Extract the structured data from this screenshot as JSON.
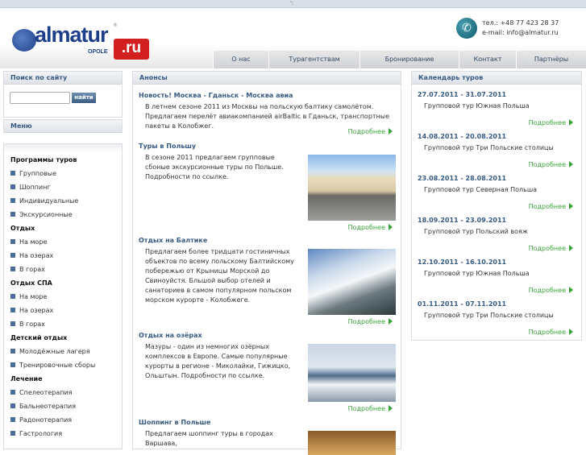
{
  "topbar": {
    "mark": "':"
  },
  "logo": {
    "word": "almatur",
    "sub": "OPOLE",
    "tld": ".ru",
    "reg": "®"
  },
  "contact": {
    "phone": "тел.: +48 77 423 28 37",
    "email": "e-mail: info@almatur.ru"
  },
  "nav": [
    "О нас",
    "Турагентствам",
    "Бронирование",
    "Контакт",
    "Партнёры"
  ],
  "search": {
    "title": "Поиск по сайту",
    "value": "",
    "button": "найти"
  },
  "menu": {
    "title": "Меню",
    "items": [
      {
        "t": "Программы туров",
        "cat": true
      },
      {
        "t": "Групповые"
      },
      {
        "t": "Шоппинг"
      },
      {
        "t": "Индивидуальные"
      },
      {
        "t": "Экскурсионные"
      },
      {
        "t": "Отдых",
        "cat": true
      },
      {
        "t": "На море"
      },
      {
        "t": "На озерах"
      },
      {
        "t": "В горах"
      },
      {
        "t": "Отдых СПА",
        "cat": true
      },
      {
        "t": "На море"
      },
      {
        "t": "На озерах"
      },
      {
        "t": "В горах"
      },
      {
        "t": "Детский отдых",
        "cat": true
      },
      {
        "t": "Молодёжные лагеря"
      },
      {
        "t": "Тренировочные сборы"
      },
      {
        "t": "Лечение",
        "cat": true
      },
      {
        "t": "Спелеотерапия"
      },
      {
        "t": "Бальнеотерапия"
      },
      {
        "t": "Радонотерапия"
      },
      {
        "t": "Гастрология"
      }
    ]
  },
  "news": {
    "title": "Анонсы",
    "more": "Подробнее",
    "items": [
      {
        "title": "Новость! Москва - Гданьск - Москва авиа",
        "text": "В летнем сезоне 2011 из Москвы на польскую балтику самолётом. Предлагаем перелёт авиакомпанией airBaltic в Гданьск, транспортные пакеты в Колобжег.",
        "img": null
      },
      {
        "title": "Туры в Польшу",
        "text": "В сезоне 2011 предлагаем групповые сбоные экскурсионные туры по Польше. Подробности по ссылке.",
        "img": "city"
      },
      {
        "title": "Отдых на Балтике",
        "text": "Предлагаем более тридцати гостиничных объектов по всему польскому Балтийскому побережью от Крыницы Морской до Свиноуйстя. Бльшой выбор отелей и санаториев в самом популярном польском морском курорте - Колобжеге.",
        "img": "sea"
      },
      {
        "title": "Отдых на озёрах",
        "text": "Мазуры - один из немногих озёрных комплексов в Европе. Самые популярные курорты в регионе - Миколайки, Гижицко, Ольштын. Подробности по ссылке.",
        "img": "lake"
      },
      {
        "title": "Шоппинг в Польше",
        "text": "Предлагаем шоппинг туры в городах Варшава,",
        "img": "shop"
      }
    ]
  },
  "calendar": {
    "title": "Календарь туров",
    "more": "Подробнее",
    "items": [
      {
        "date": "27.07.2011 - 31.07.2011",
        "name": "Групповой тур Южная Польша"
      },
      {
        "date": "14.08.2011 - 20.08.2011",
        "name": "Групповой тур Три Польские столицы"
      },
      {
        "date": "23.08.2011 - 28.08.2011",
        "name": "Групповой тур Северная Польша"
      },
      {
        "date": "18.09.2011 - 23.09.2011",
        "name": "Групповой тур Польский вояж"
      },
      {
        "date": "12.10.2011 - 16.10.2011",
        "name": "Групповой тур Южная Польша"
      },
      {
        "date": "01.11.2011 - 07.11.2011",
        "name": "Групповой тур Три Польские столицы"
      }
    ]
  }
}
